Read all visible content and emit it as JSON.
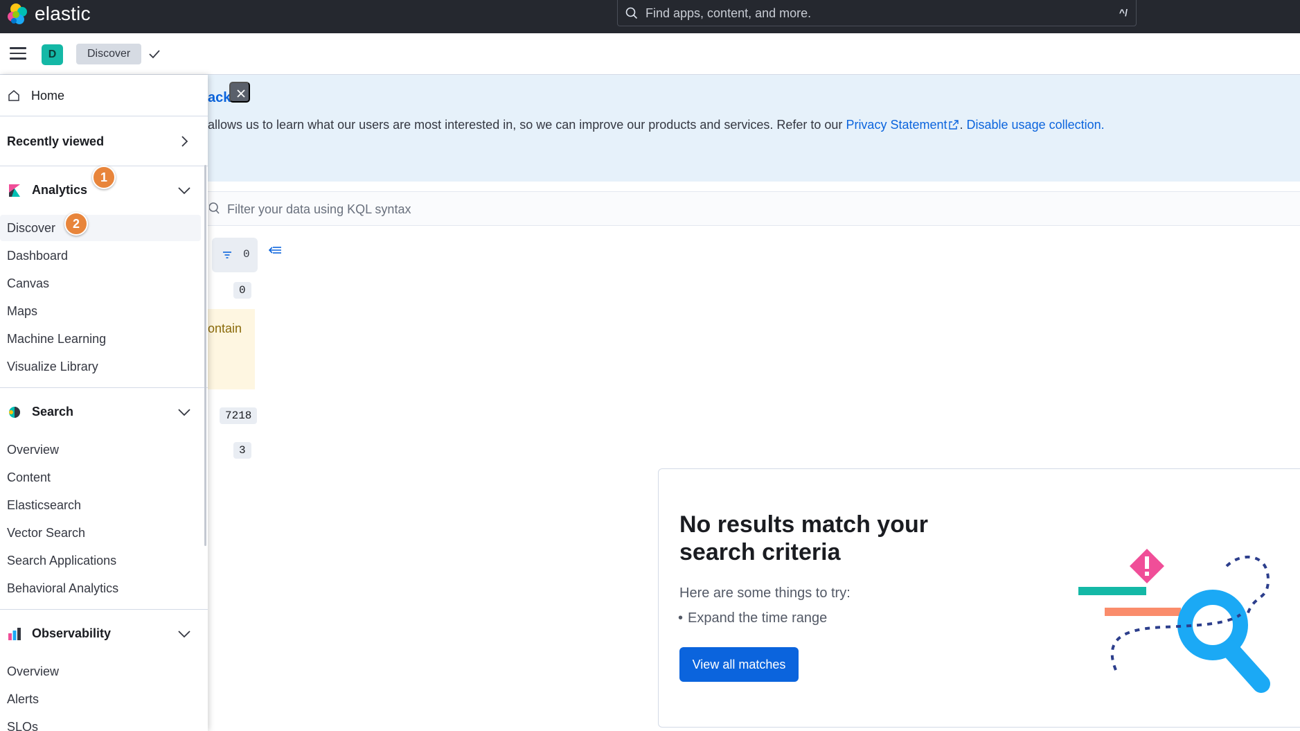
{
  "header": {
    "brand": "elastic",
    "search_placeholder": "Find apps, content, and more.",
    "shortcut": "^/"
  },
  "subheader": {
    "space_initial": "D",
    "breadcrumb": "Discover"
  },
  "callout": {
    "title_fragment": "ack",
    "text_fragment": "allows us to learn what our users are most interested in, so we can improve our products and services. Refer to our ",
    "privacy_link": "Privacy Statement",
    "separator": ". ",
    "disable_link": "Disable usage collection."
  },
  "query": {
    "placeholder": "Filter your data using KQL syntax"
  },
  "fields_panel": {
    "filter_count": "0",
    "count_2": "0",
    "warning_fragment": "ontain",
    "count_3": "7218",
    "count_4": "3"
  },
  "empty_state": {
    "title": "No results match your search criteria",
    "subtitle": "Here are some things to try:",
    "suggestion": "Expand the time range",
    "button": "View all matches"
  },
  "nav": {
    "home": "Home",
    "recently_viewed": "Recently viewed",
    "analytics": {
      "label": "Analytics",
      "items": [
        "Discover",
        "Dashboard",
        "Canvas",
        "Maps",
        "Machine Learning",
        "Visualize Library"
      ]
    },
    "search": {
      "label": "Search",
      "items": [
        "Overview",
        "Content",
        "Elasticsearch",
        "Vector Search",
        "Search Applications",
        "Behavioral Analytics"
      ]
    },
    "observability": {
      "label": "Observability",
      "items": [
        "Overview",
        "Alerts",
        "SLOs"
      ]
    }
  },
  "steps": [
    "1",
    "2"
  ],
  "colors": {
    "header_bg": "#25282f",
    "accent": "#0b64dd",
    "callout_bg": "#e6f1fa",
    "step_badge": "#e8853b"
  }
}
